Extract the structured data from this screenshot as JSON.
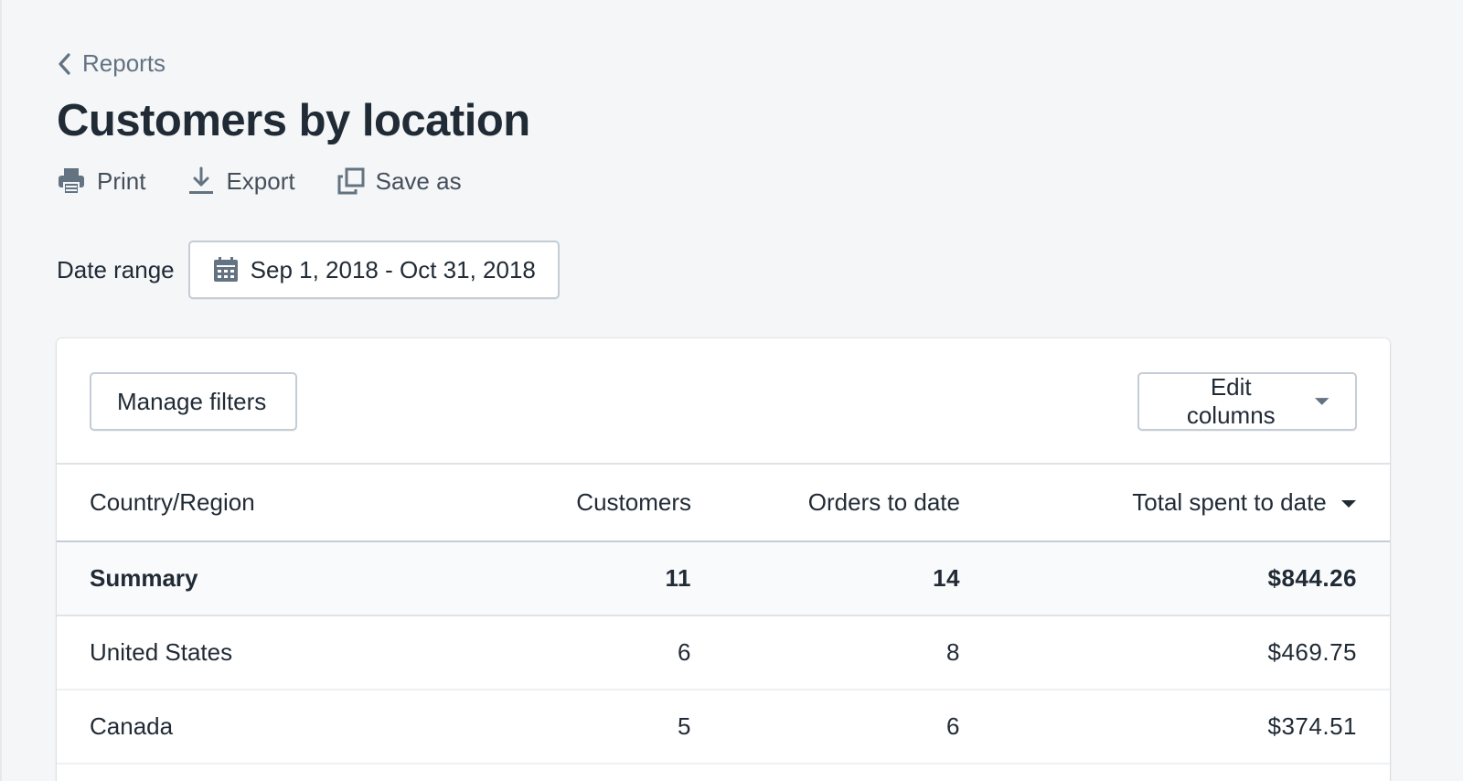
{
  "breadcrumb": {
    "label": "Reports"
  },
  "page": {
    "title": "Customers by location"
  },
  "actions": {
    "print": "Print",
    "export": "Export",
    "save_as": "Save as"
  },
  "date_range": {
    "label": "Date range",
    "value": "Sep 1, 2018 - Oct 31, 2018"
  },
  "toolbar": {
    "manage_filters": "Manage filters",
    "edit_columns": "Edit columns"
  },
  "table": {
    "headers": {
      "country": "Country/Region",
      "customers": "Customers",
      "orders": "Orders to date",
      "total": "Total spent to date"
    },
    "summary": {
      "label": "Summary",
      "customers": "11",
      "orders": "14",
      "total": "$844.26"
    },
    "rows": [
      {
        "country": "United States",
        "customers": "6",
        "orders": "8",
        "total": "$469.75"
      },
      {
        "country": "Canada",
        "customers": "5",
        "orders": "6",
        "total": "$374.51"
      }
    ]
  },
  "colors": {
    "background": "#f4f6f8",
    "text": "#212b36",
    "subdued": "#637381",
    "border": "#c4cdd5"
  }
}
